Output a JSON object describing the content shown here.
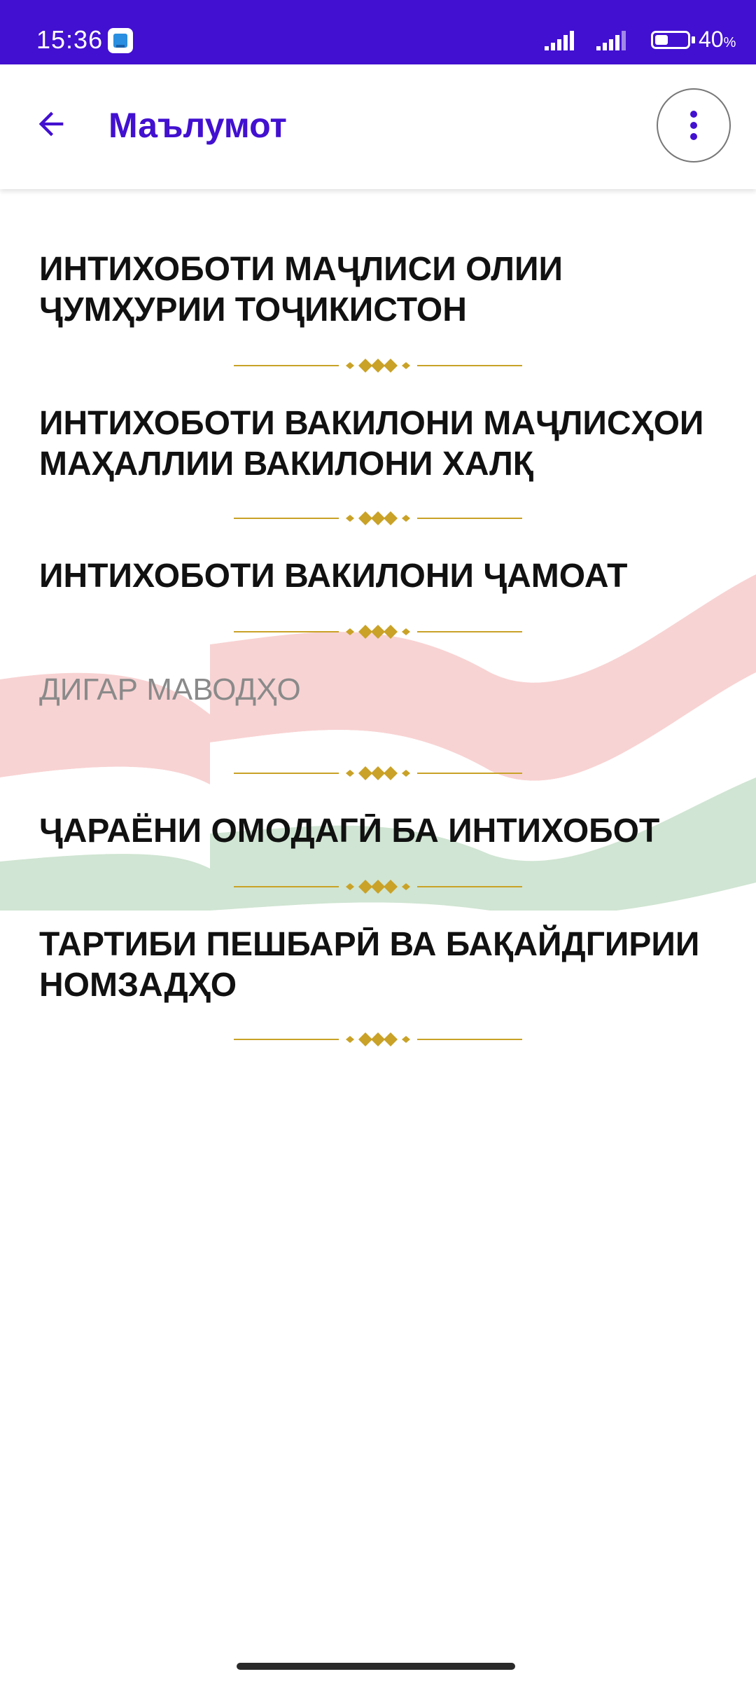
{
  "status_bar": {
    "time": "15:36",
    "battery_percent": "40",
    "battery_symbol": "%",
    "battery_level": 0.4
  },
  "app_bar": {
    "title": "Маълумот",
    "back_icon": "arrow-back-icon",
    "menu_icon": "more-vert-icon"
  },
  "items": [
    {
      "label": "ИНТИХОБОТИ МАҶЛИСИ ОЛИИ ҶУМҲУРИИ ТОҶИКИСТОН",
      "type": "link"
    },
    {
      "label": "ИНТИХОБОТИ ВАКИЛОНИ МАҶЛИСҲОИ МАҲАЛЛИИ ВАКИЛОНИ ХАЛҚ",
      "type": "link"
    },
    {
      "label": "ИНТИХОБОТИ ВАКИЛОНИ ҶАМОАТ",
      "type": "link"
    },
    {
      "label": "ДИГАР МАВОДҲО",
      "type": "section"
    },
    {
      "label": "ҶАРАЁНИ ОМОДАГӢ БА ИНТИХОБОТ",
      "type": "link"
    },
    {
      "label": "ТАРТИБИ ПЕШБАРӢ ВА БАҚАЙДГИРИИ НОМЗАДҲО",
      "type": "link"
    }
  ],
  "colors": {
    "accent": "#4210d0",
    "divider_gold": "#c9a227",
    "flag_red": "#e03a3a",
    "flag_green": "#2e8b3a"
  }
}
